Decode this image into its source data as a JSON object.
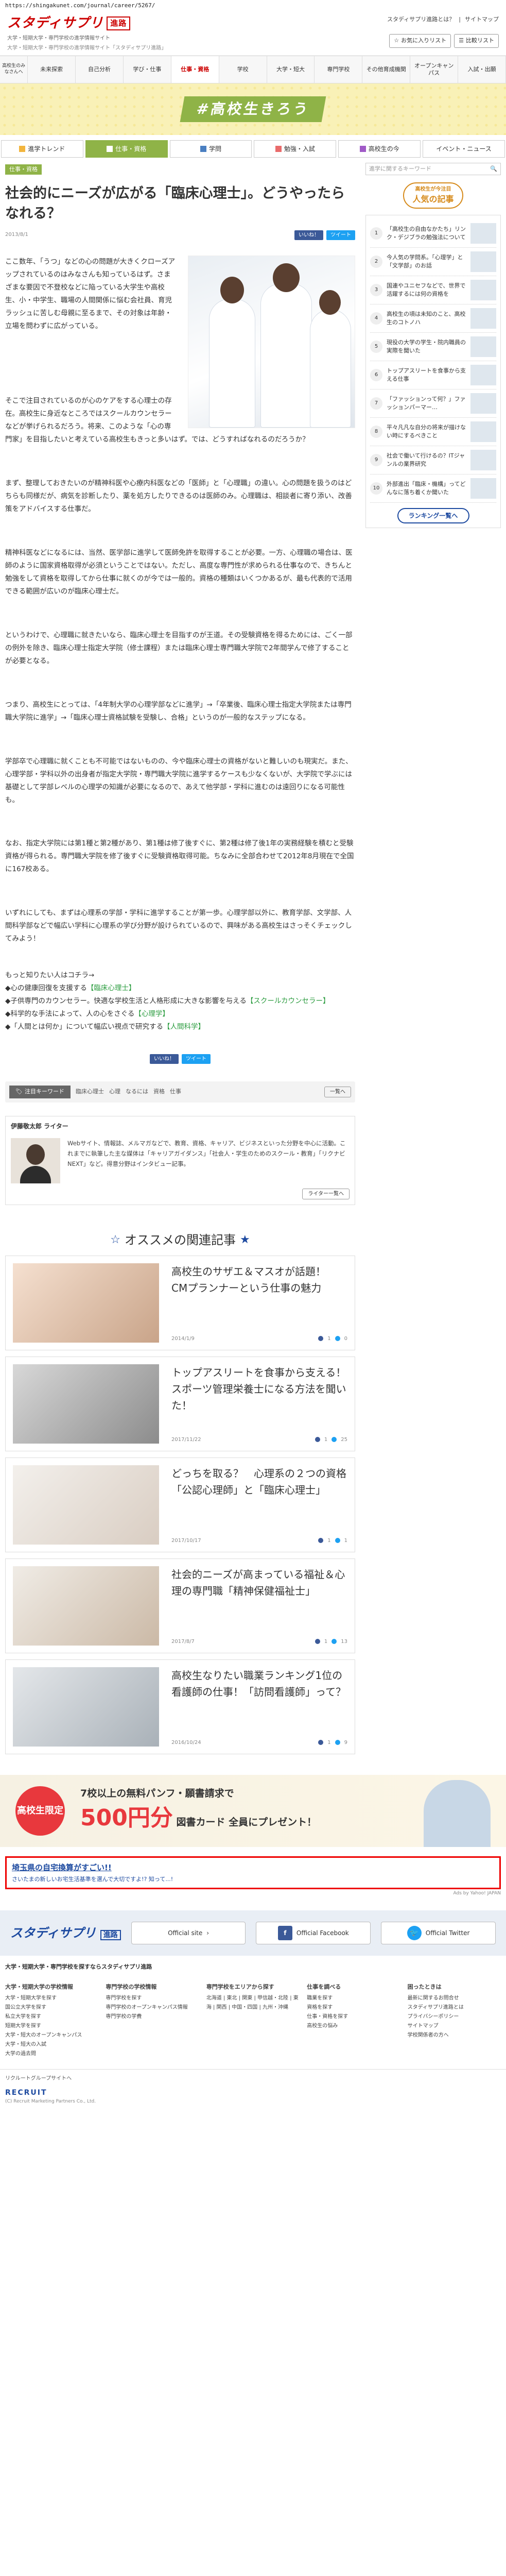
{
  "url": "https://shingakunet.com/journal/career/5267/",
  "header": {
    "brand": "スタディサプリ",
    "brand_badge": "進路",
    "subnote": "大学・短期大学・専門学校の進学情報サイト",
    "crumb": "大学・短期大学・専門学校の進学情報サイト「スタディサプリ進路」",
    "toplinks": [
      "スタディサプリ進路とは？",
      "サイトマップ"
    ],
    "btn_favorite": "お気に入りリスト",
    "btn_compare": "比較リスト"
  },
  "gnav": [
    "高校生のみなさんへ",
    "未来探索",
    "自己分析",
    "学び・仕事",
    "仕事・資格",
    "学校",
    "大学・短大",
    "専門学校",
    "その他育成機関",
    "オープンキャンパス",
    "入試・出願"
  ],
  "banner": {
    "title": "#高校生きろう"
  },
  "catnav": [
    "進学トレンド",
    "仕事・資格",
    "学問",
    "勉強・入試",
    "高校生の今",
    "イベント・ニュース"
  ],
  "article": {
    "tag": "仕事・資格",
    "title": "社会的にニーズが広がる「臨床心理士」。どうやったらなれる？",
    "date": "2013/8/1",
    "share_fb": "いいね！",
    "share_tw": "ツイート",
    "paragraphs": [
      "ここ数年、「うつ」などの心の問題が大きくクローズアップされているのはみなさんも知っているはず。さまざまな要因で不登校などに陥っている大学生や高校生、小・中学生、職場の人間関係に悩む会社員、育児ラッシュに苦しむ母親に至るまで、その対象は年齢・立場を問わずに広がっている。",
      "そこで注目されているのが心のケアをする心理士の存在。高校生に身近なところではスクールカウンセラーなどが挙げられるだろう。将来、このような「心の専門家」を目指したいと考えている高校生もきっと多いはず。では、どうすればなれるのだろうか？",
      "まず、整理しておきたいのが精神科医や心療内科医などの「医師」と「心理職」の違い。心の問題を扱うのはどちらも同様だが、病気を診断したり、薬を処方したりできるのは医師のみ。心理職は、相談者に寄り添い、改善策をアドバイスする仕事だ。",
      "精神科医などになるには、当然、医学部に進学して医師免許を取得することが必要。一方、心理職の場合は、医師のように国家資格取得が必須ということではない。ただし、高度な専門性が求められる仕事なので、きちんと勉強をして資格を取得してから仕事に就くのが今では一般的。資格の種類はいくつかあるが、最も代表的で活用できる範囲が広いのが臨床心理士だ。",
      "というわけで、心理職に就きたいなら、臨床心理士を目指すのが王道。その受験資格を得るためには、ごく一部の例外を除き、臨床心理士指定大学院（修士課程）または臨床心理士専門職大学院で2年間学んで修了することが必要となる。",
      "つまり、高校生にとっては、「4年制大学の心理学部などに進学」→「卒業後、臨床心理士指定大学院または専門職大学院に進学」→「臨床心理士資格試験を受験し、合格」というのが一般的なステップになる。",
      "学部卒で心理職に就くことも不可能ではないものの、今や臨床心理士の資格がないと難しいのも現実だ。また、心理学部・学科以外の出身者が指定大学院・専門職大学院に進学するケースも少なくないが、大学院で学ぶには基礎として学部レベルの心理学の知識が必要になるので、あえて他学部・学科に進むのは遠回りになる可能性も。",
      "なお、指定大学院には第1種と第2種があり、第1種は修了後すぐに、第2種は修了後1年の実務経験を積むと受験資格が得られる。専門職大学院を修了後すぐに受験資格取得可能。ちなみに全部合わせて2012年8月現在で全国に167校ある。",
      "いずれにしても、まずは心理系の学部・学科に進学することが第一歩。心理学部以外に、教育学部、文学部、人間科学部などで幅広い学科に心理系の学び分野が設けられているので、興味がある高校生はさっそくチェックしてみよう！",
      "もっと知りたい人はコチラ→"
    ],
    "links": [
      {
        "pre": "◆心の健康回復を支援する",
        "label": "【臨床心理士】"
      },
      {
        "pre": "◆子供専門のカウンセラー。快適な学校生活と人格形成に大きな影響を与える",
        "label": "【スクールカウンセラー】"
      },
      {
        "pre": "◆科学的な手法によって、人の心をさぐる",
        "label": "【心理学】"
      },
      {
        "pre": "◆「人間とは何か」について幅広い視点で研究する",
        "label": "【人間科学】"
      }
    ],
    "bottom_share_fb": "いいね！",
    "bottom_share_tw": "ツイート"
  },
  "keywords": {
    "label": "注目キーワード",
    "items": [
      "臨床心理士",
      "心理",
      "なるには",
      "資格",
      "仕事"
    ],
    "more": "一覧へ"
  },
  "writer": {
    "heading": "伊藤敬太郎 ライター",
    "bio": "Webサイト、情報誌、メルマガなどで、教育、資格、キャリア、ビジネスといった分野を中心に活動。これまでに執筆した主な媒体は「キャリアガイダンス」「社会人・学生のためのスクール・教育」「リクナビNEXT」など。得意分野はインタビュー記事。",
    "more": "ライター一覧へ"
  },
  "related": {
    "heading": "オススメの関連記事",
    "items": [
      {
        "title": "高校生のサザエ＆マスオが話題！　CMプランナーという仕事の魅力",
        "date": "2014/1/9",
        "fb": "1",
        "tw": "0"
      },
      {
        "title": "トップアスリートを食事から支える！スポーツ管理栄養士になる方法を聞いた！",
        "date": "2017/11/22",
        "fb": "1",
        "tw": "25"
      },
      {
        "title": "どっちを取る？　心理系の２つの資格「公認心理師」と「臨床心理士」",
        "date": "2017/10/17",
        "fb": "1",
        "tw": "1"
      },
      {
        "title": "社会的ニーズが高まっている福祉＆心理の専門職「精神保健福祉士」",
        "date": "2017/8/7",
        "fb": "1",
        "tw": "13"
      },
      {
        "title": "高校生なりたい職業ランキング1位の看護師の仕事！「訪問看護師」って？",
        "date": "2016/10/24",
        "fb": "1",
        "tw": "9"
      }
    ]
  },
  "sidebar": {
    "search_placeholder": "進学に関するキーワード",
    "rank_sub": "高校生が今注目",
    "rank_title": "人気の記事",
    "rank_items": [
      "「高校生の自由なかたち」リンク・デジブラの勉強法について",
      "今人気の学問系。「心理学」と「文学部」のお話",
      "国連やユニセフなどで、世界で活躍するには何の資格を",
      "高校生の頃は未知のこと、高校生のコトノハ",
      "現役の大学の学生・院内職員の実際を聞いた",
      "トップアスリートを食事から支える仕事",
      "「ファッションって何？」ファッションパーマー…",
      "平々凡凡な自分の将来が描けない時にするべきこと",
      "社会で働いて行けるの？ITジャンルの業界研究",
      "外部進出「臨床・機構」ってどんなに落ち着くか聞いた"
    ],
    "rank_btn": "ランキング一覧へ"
  },
  "promo": {
    "badge": "高校生限定",
    "line1": "7校以上の無料パンフ・願書請求で",
    "amount": "500円分",
    "card": "図書カード",
    "line2": "全員にプレゼント！"
  },
  "sticky": {
    "link": "埼玉県の自宅換算がすごい!!",
    "sub": "さいたまの新しいお宅生活基準を選んで大切ですよ!? 知って...!"
  },
  "ads_by": "Ads by Yahoo! JAPAN",
  "footer": {
    "brand": "スタディサプリ",
    "brand_badge": "進路",
    "official_site": "Official site",
    "facebook": "Official Facebook",
    "twitter": "Official Twitter",
    "col_heading": "大学・短期大学・専門学校を探すならスタディサプリ進路",
    "cols": [
      {
        "title": "大学・短期大学の学校情報",
        "items": [
          "大学・短期大学を探す",
          "国公立大学を探す",
          "私立大学を探す",
          "短期大学を探す",
          "大学・短大のオープンキャンパス",
          "大学・短大の入試",
          "大学の過去問"
        ]
      },
      {
        "title": "専門学校の学校情報",
        "items": [
          "専門学校を探す",
          "専門学校のオープンキャンパス情報",
          "専門学校の学費"
        ]
      },
      {
        "title": "専門学校をエリアから探す",
        "items": [
          "北海道",
          "東北",
          "関東",
          "甲信越・北陸",
          "東海",
          "関西",
          "中国・四国",
          "九州・沖縄"
        ]
      },
      {
        "title": "仕事を調べる",
        "items": [
          "職業を探す",
          "資格を探す",
          "仕事・資格を探す",
          "高校生の悩み"
        ]
      },
      {
        "title": "困ったときは",
        "items": [
          "最新に関するお問合せ",
          "スタディサプリ進路とは",
          "プライバシーポリシー",
          "サイトマップ",
          "学校関係者の方へ"
        ]
      }
    ],
    "group_link": "リクルートグループサイトへ",
    "recruit": "RECRUIT",
    "copyright": "(C) Recruit Marketing Partners Co., Ltd."
  }
}
